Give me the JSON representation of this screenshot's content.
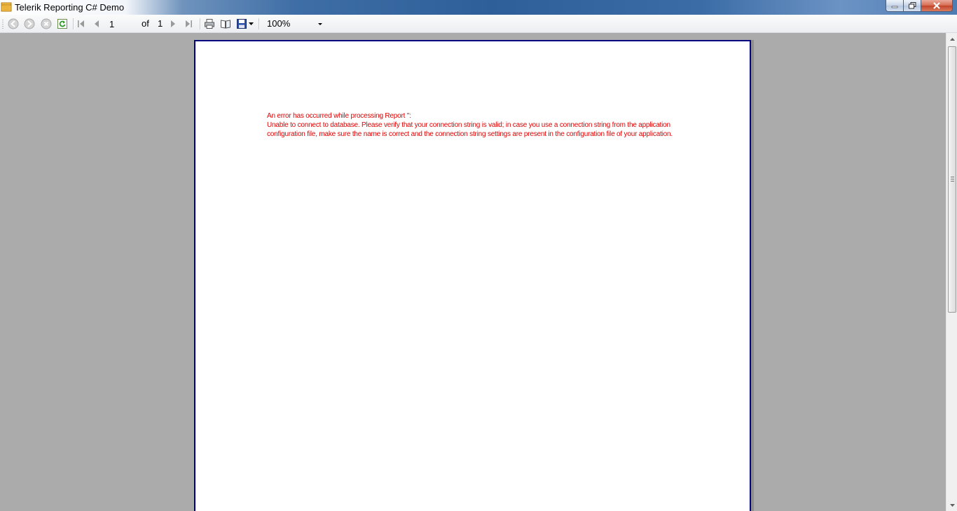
{
  "window": {
    "title": "Telerik Reporting C# Demo"
  },
  "toolbar": {
    "back_icon": "back-icon",
    "forward_icon": "forward-icon",
    "stop_icon": "stop-icon",
    "refresh_icon": "refresh-icon",
    "first_page_icon": "first-page-icon",
    "prev_page_icon": "previous-page-icon",
    "current_page": "1",
    "of_label": "of",
    "total_pages": "1",
    "next_page_icon": "next-page-icon",
    "last_page_icon": "last-page-icon",
    "print_icon": "print-icon",
    "print_preview_icon": "print-preview-icon",
    "export_icon": "save-icon",
    "zoom": "100%"
  },
  "report": {
    "error_title": "An error has occurred while processing Report '':",
    "error_message": "Unable to connect to database. Please verify that your connection string is valid; in case you use a connection string from the application configuration file, make sure the name is correct and the connection string settings are present in the configuration file of your application."
  },
  "colors": {
    "error_text": "#e00000",
    "page_border": "#000080",
    "viewer_background": "#ababab"
  }
}
